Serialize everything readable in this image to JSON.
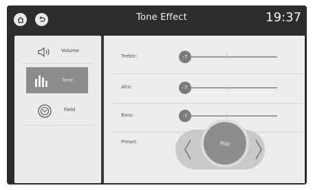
{
  "header": {
    "title": "Tone Effect",
    "clock": "19:37",
    "home_icon": "home-icon",
    "back_icon": "back-arrow-icon"
  },
  "menu": {
    "items": [
      {
        "label": "Volume",
        "icon": "speaker-icon",
        "selected": false
      },
      {
        "label": "Tone",
        "icon": "equalizer-bars-icon",
        "selected": true
      },
      {
        "label": "Field",
        "icon": "sound-field-icon",
        "selected": false
      }
    ]
  },
  "tone": {
    "rows": [
      {
        "label": "Treble:",
        "value": "-7",
        "level": "-7"
      },
      {
        "label": "Alto:",
        "value": "-7",
        "level": "-7"
      },
      {
        "label": "Bass:",
        "value": "-7",
        "level": "-7"
      }
    ],
    "preset_label": "Preset:",
    "preset_value": "Pop",
    "prev_icon": "chevron-left-icon",
    "next_icon": "chevron-right-icon"
  },
  "colors": {
    "background": "#2b2b2b",
    "panel": "#ebebeb",
    "selected": "#8c8c8c",
    "knob": "#7b7b7b"
  }
}
